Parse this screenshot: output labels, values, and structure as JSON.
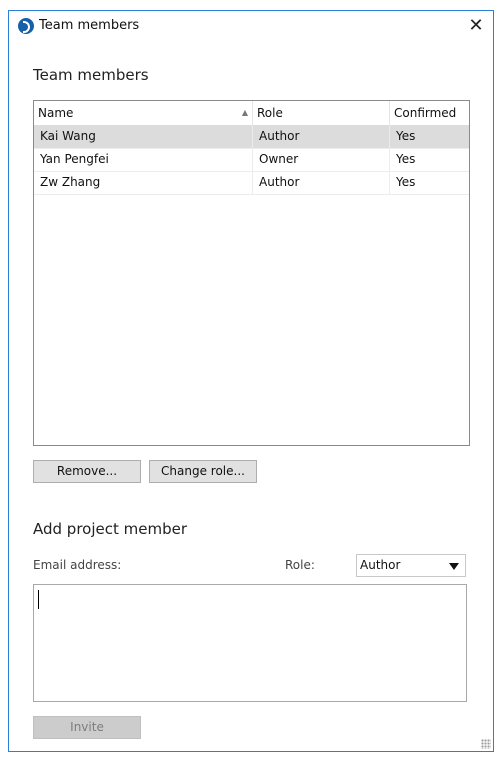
{
  "window": {
    "title": "Team members",
    "close_glyph": "✕"
  },
  "members": {
    "section_title": "Team members",
    "columns": [
      "Name",
      "Role",
      "Confirmed"
    ],
    "rows": [
      {
        "name": "Kai Wang",
        "role": "Author",
        "confirmed": "Yes",
        "selected": true
      },
      {
        "name": "Yan Pengfei",
        "role": "Owner",
        "confirmed": "Yes",
        "selected": false
      },
      {
        "name": "Zw Zhang",
        "role": "Author",
        "confirmed": "Yes",
        "selected": false
      }
    ],
    "remove_label": "Remove...",
    "change_role_label": "Change role..."
  },
  "add_member": {
    "section_title": "Add project member",
    "email_label": "Email address:",
    "role_label": "Role:",
    "role_value": "Author",
    "email_value": "",
    "invite_label": "Invite"
  },
  "icons": {
    "app": "app-logo-icon",
    "close": "close-icon",
    "sort": "sort-ascending-icon",
    "dropdown": "chevron-down-icon",
    "resize": "resize-grip-icon"
  }
}
